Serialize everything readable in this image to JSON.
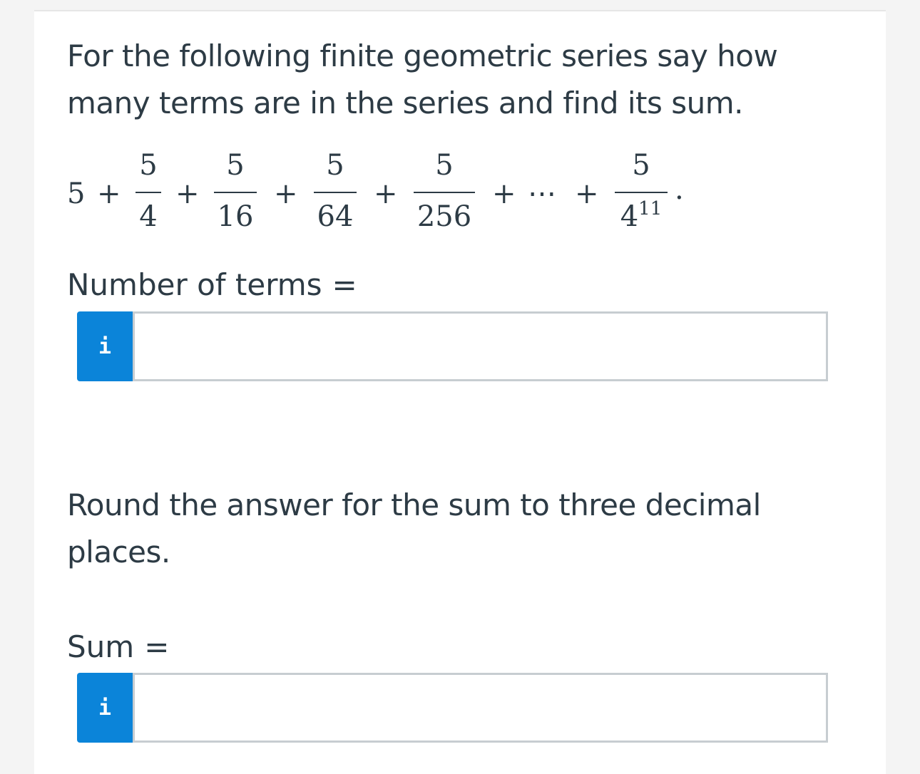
{
  "question": {
    "prompt": "For the following finite geometric series say how many terms are in the series and find its sum.",
    "expression": {
      "lead_term": "5",
      "plus": "+",
      "ellipsis": "⋯",
      "period": ".",
      "fractions": [
        {
          "numerator": "5",
          "denominator": "4"
        },
        {
          "numerator": "5",
          "denominator": "16"
        },
        {
          "numerator": "5",
          "denominator": "64"
        },
        {
          "numerator": "5",
          "denominator": "256"
        },
        {
          "numerator": "5",
          "denominator_base": "4",
          "denominator_exponent": "11"
        }
      ]
    },
    "rounding_note": "Round the answer for the sum to three decimal places."
  },
  "fields": {
    "terms": {
      "label": "Number of terms",
      "equals": "=",
      "info_icon": "i",
      "value": ""
    },
    "sum": {
      "label": "Sum",
      "equals": "=",
      "info_icon": "i",
      "value": ""
    }
  }
}
